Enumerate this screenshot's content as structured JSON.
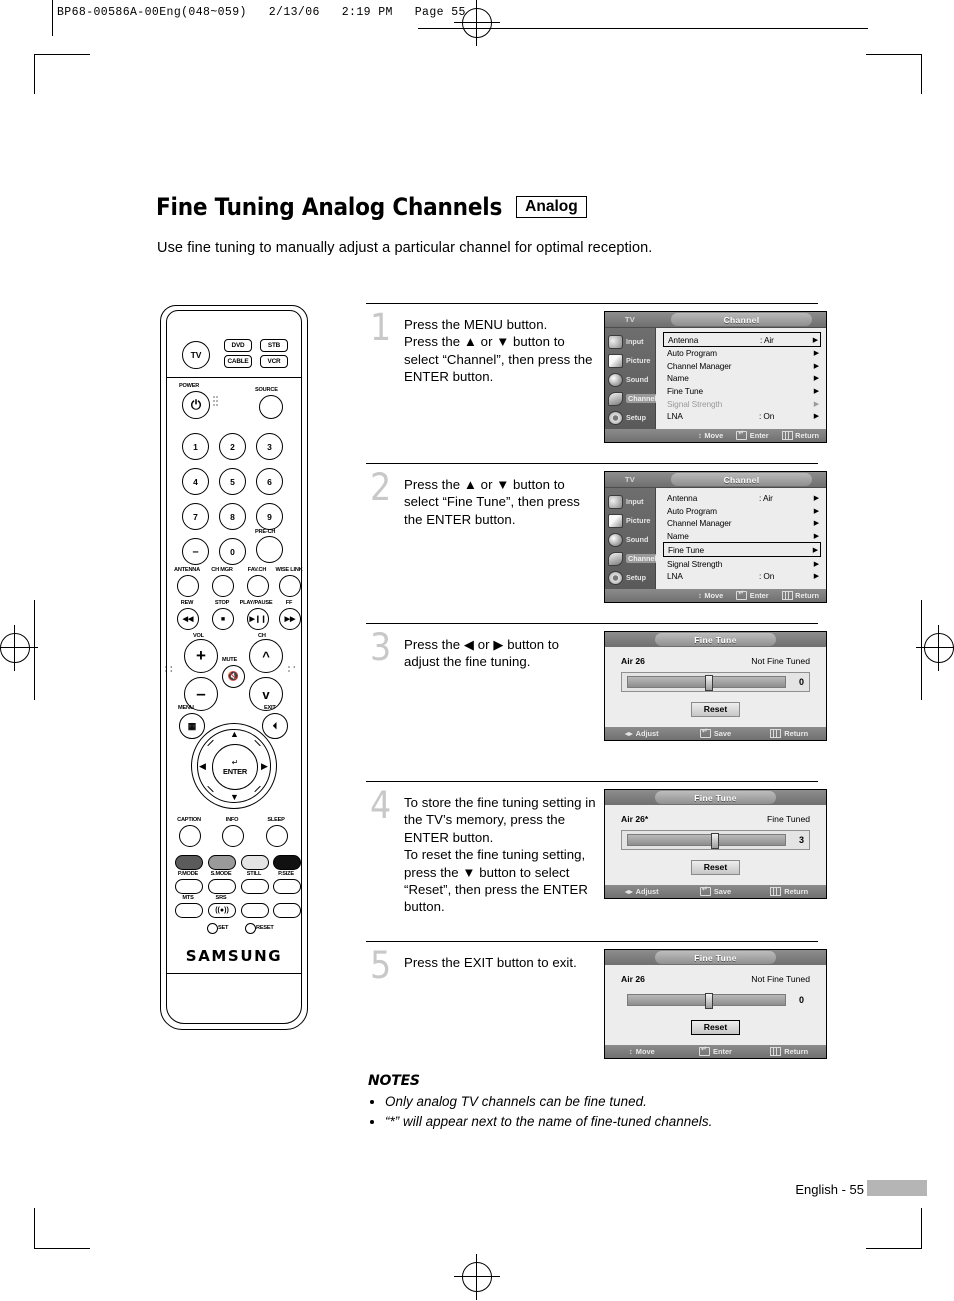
{
  "print_header": "BP68-00586A-00Eng(048~059)   2/13/06   2:19 PM   Page 55",
  "title": "Fine Tuning Analog Channels",
  "badge": "Analog",
  "subtitle": "Use fine tuning to manually adjust a particular channel for optimal reception.",
  "remote": {
    "device_tv": "TV",
    "device_dvd": "DVD",
    "device_stb": "STB",
    "device_cable": "CABLE",
    "device_vcr": "VCR",
    "power_label": "POWER",
    "source_label": "SOURCE",
    "keys": [
      "1",
      "2",
      "3",
      "4",
      "5",
      "6",
      "7",
      "8",
      "9",
      "–",
      "0",
      ""
    ],
    "prech": "PRE-CH",
    "row_labels": [
      "ANTENNA",
      "CH MGR",
      "FAV.CH",
      "WISE LINK"
    ],
    "transport_labels": [
      "REW",
      "STOP",
      "PLAY/PAUSE",
      "FF"
    ],
    "vol_label": "VOL",
    "ch_label": "CH",
    "mute_label": "MUTE",
    "menu_label": "MENU",
    "exit_label": "EXIT",
    "enter_label": "ENTER",
    "bottom_labels": [
      "CAPTION",
      "INFO",
      "SLEEP"
    ],
    "mode_labels": [
      "P.MODE",
      "S.MODE",
      "STILL",
      "P.SIZE"
    ],
    "mts_label": "MTS",
    "srs_label": "SRS",
    "set_label": "SET",
    "reset_label": "RESET",
    "brand": "SAMSUNG"
  },
  "steps": [
    {
      "num": "1",
      "text": "Press the MENU button.\nPress the ▲ or ▼ button to select “Channel”, then press the ENTER button."
    },
    {
      "num": "2",
      "text": "Press the ▲ or ▼ button to select “Fine Tune”, then press the ENTER button."
    },
    {
      "num": "3",
      "text": "Press the ◀ or ▶ button to adjust the fine tuning."
    },
    {
      "num": "4",
      "text": "To store the fine tuning setting in the TV’s memory, press the ENTER button.\nTo reset the fine tuning setting, press the ▼ button to select “Reset”, then press the ENTER button."
    },
    {
      "num": "5",
      "text": "Press the EXIT button to exit."
    }
  ],
  "osd": {
    "tv_label": "TV",
    "title": "Channel",
    "sidebar": [
      "Input",
      "Picture",
      "Sound",
      "Channel",
      "Setup"
    ],
    "sidebar_selected": "Channel",
    "rows": [
      {
        "name": "Antenna",
        "value": ": Air",
        "arrow": "▶"
      },
      {
        "name": "Auto Program",
        "value": "",
        "arrow": "▶"
      },
      {
        "name": "Channel Manager",
        "value": "",
        "arrow": "▶"
      },
      {
        "name": "Name",
        "value": "",
        "arrow": "▶"
      },
      {
        "name": "Fine Tune",
        "value": "",
        "arrow": "▶"
      },
      {
        "name": "Signal Strength",
        "value": "",
        "arrow": "▶"
      },
      {
        "name": "LNA",
        "value": ": On",
        "arrow": "▶"
      }
    ],
    "screen1_selected": "Antenna",
    "screen2_selected": "Fine Tune",
    "footer": {
      "move": "Move",
      "enter": "Enter",
      "return": "Return"
    }
  },
  "fine_tune": {
    "title": "Fine Tune",
    "reset_label": "Reset",
    "screens": [
      {
        "channel": "Air 26",
        "status": "Not Fine Tuned",
        "value": "0",
        "thumb_pct": 49,
        "reset_selected": false,
        "boxed_slider": true,
        "footer": {
          "left": "Adjust",
          "mid": "Save",
          "right": "Return"
        },
        "left_glyph": "adjust"
      },
      {
        "channel": "Air 26*",
        "status": "Fine Tuned",
        "value": "3",
        "thumb_pct": 53,
        "reset_selected": false,
        "boxed_slider": true,
        "footer": {
          "left": "Adjust",
          "mid": "Save",
          "right": "Return"
        },
        "left_glyph": "adjust"
      },
      {
        "channel": "Air 26",
        "status": "Not Fine Tuned",
        "value": "0",
        "thumb_pct": 49,
        "reset_selected": true,
        "boxed_slider": false,
        "footer": {
          "left": "Move",
          "mid": "Enter",
          "right": "Return"
        },
        "left_glyph": "move"
      }
    ]
  },
  "notes": {
    "heading": "NOTES",
    "items": [
      "Only analog TV channels can be fine tuned.",
      "“*” will appear next to the name of fine-tuned channels."
    ]
  },
  "footer": "English - 55"
}
